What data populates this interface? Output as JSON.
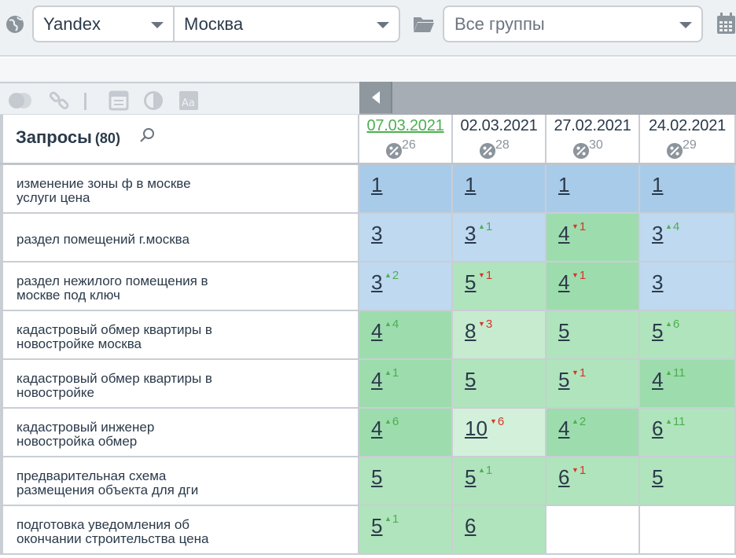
{
  "toolbar": {
    "engine_value": "Yandex",
    "region_value": "Москва",
    "groups_placeholder": "Все группы"
  },
  "table": {
    "title": "Запросы",
    "count": "(80)",
    "dates": [
      {
        "date": "07.03.2021",
        "pct": "26"
      },
      {
        "date": "02.03.2021",
        "pct": "28"
      },
      {
        "date": "27.02.2021",
        "pct": "30"
      },
      {
        "date": "24.02.2021",
        "pct": "29"
      }
    ],
    "rows": [
      {
        "line1": "изменение зоны ф в москве",
        "line2": "услуги цена",
        "cells": [
          {
            "pos": "1",
            "delta": "",
            "dir": "",
            "bg": "blue"
          },
          {
            "pos": "1",
            "delta": "",
            "dir": "",
            "bg": "blue"
          },
          {
            "pos": "1",
            "delta": "",
            "dir": "",
            "bg": "blue"
          },
          {
            "pos": "1",
            "delta": "",
            "dir": "",
            "bg": "blue"
          }
        ]
      },
      {
        "line1": "раздел помещений г.москва",
        "line2": "",
        "cells": [
          {
            "pos": "3",
            "delta": "",
            "dir": "",
            "bg": "lblue"
          },
          {
            "pos": "3",
            "delta": "1",
            "dir": "up",
            "bg": "lblue"
          },
          {
            "pos": "4",
            "delta": "1",
            "dir": "down",
            "bg": "green"
          },
          {
            "pos": "3",
            "delta": "4",
            "dir": "up",
            "bg": "lblue"
          }
        ]
      },
      {
        "line1": "раздел нежилого помещения в",
        "line2": "москве под ключ",
        "cells": [
          {
            "pos": "3",
            "delta": "2",
            "dir": "up",
            "bg": "lblue"
          },
          {
            "pos": "5",
            "delta": "1",
            "dir": "down",
            "bg": "mgreen"
          },
          {
            "pos": "4",
            "delta": "1",
            "dir": "down",
            "bg": "green"
          },
          {
            "pos": "3",
            "delta": "",
            "dir": "",
            "bg": "lblue"
          }
        ]
      },
      {
        "line1": "кадастровый обмер квартиры в",
        "line2": "новостройке москва",
        "cells": [
          {
            "pos": "4",
            "delta": "4",
            "dir": "up",
            "bg": "green"
          },
          {
            "pos": "8",
            "delta": "3",
            "dir": "down",
            "bg": "lgreen"
          },
          {
            "pos": "5",
            "delta": "",
            "dir": "",
            "bg": "mgreen"
          },
          {
            "pos": "5",
            "delta": "6",
            "dir": "up",
            "bg": "mgreen"
          }
        ]
      },
      {
        "line1": "кадастровый обмер квартиры в",
        "line2": "новостройке",
        "cells": [
          {
            "pos": "4",
            "delta": "1",
            "dir": "up",
            "bg": "green"
          },
          {
            "pos": "5",
            "delta": "",
            "dir": "",
            "bg": "mgreen"
          },
          {
            "pos": "5",
            "delta": "1",
            "dir": "down",
            "bg": "mgreen"
          },
          {
            "pos": "4",
            "delta": "11",
            "dir": "up",
            "bg": "green"
          }
        ]
      },
      {
        "line1": "кадастровый инженер",
        "line2": "новостройка обмер",
        "cells": [
          {
            "pos": "4",
            "delta": "6",
            "dir": "up",
            "bg": "green"
          },
          {
            "pos": "10",
            "delta": "6",
            "dir": "down",
            "bg": "xlgreen"
          },
          {
            "pos": "4",
            "delta": "2",
            "dir": "up",
            "bg": "green"
          },
          {
            "pos": "6",
            "delta": "11",
            "dir": "up",
            "bg": "mgreen"
          }
        ]
      },
      {
        "line1": "предварительная схема",
        "line2": "размещения объекта для дги",
        "cells": [
          {
            "pos": "5",
            "delta": "",
            "dir": "",
            "bg": "mgreen"
          },
          {
            "pos": "5",
            "delta": "1",
            "dir": "up",
            "bg": "mgreen"
          },
          {
            "pos": "6",
            "delta": "1",
            "dir": "down",
            "bg": "mgreen"
          },
          {
            "pos": "5",
            "delta": "",
            "dir": "",
            "bg": "mgreen"
          }
        ]
      },
      {
        "line1": "подготовка уведомления об",
        "line2": "окончании строительства цена",
        "cells": [
          {
            "pos": "5",
            "delta": "1",
            "dir": "up",
            "bg": "mgreen"
          },
          {
            "pos": "6",
            "delta": "",
            "dir": "",
            "bg": "mgreen"
          },
          {
            "pos": "",
            "delta": "",
            "dir": "",
            "bg": "empty"
          },
          {
            "pos": "",
            "delta": "",
            "dir": "",
            "bg": "empty"
          }
        ]
      }
    ]
  },
  "icons": [
    "globe-icon",
    "folder-icon",
    "calendar-icon",
    "toggle-icon",
    "link-icon",
    "window-icon",
    "contrast-icon",
    "font-size-icon",
    "search-icon",
    "percent-icon",
    "collapse-arrow-icon"
  ]
}
